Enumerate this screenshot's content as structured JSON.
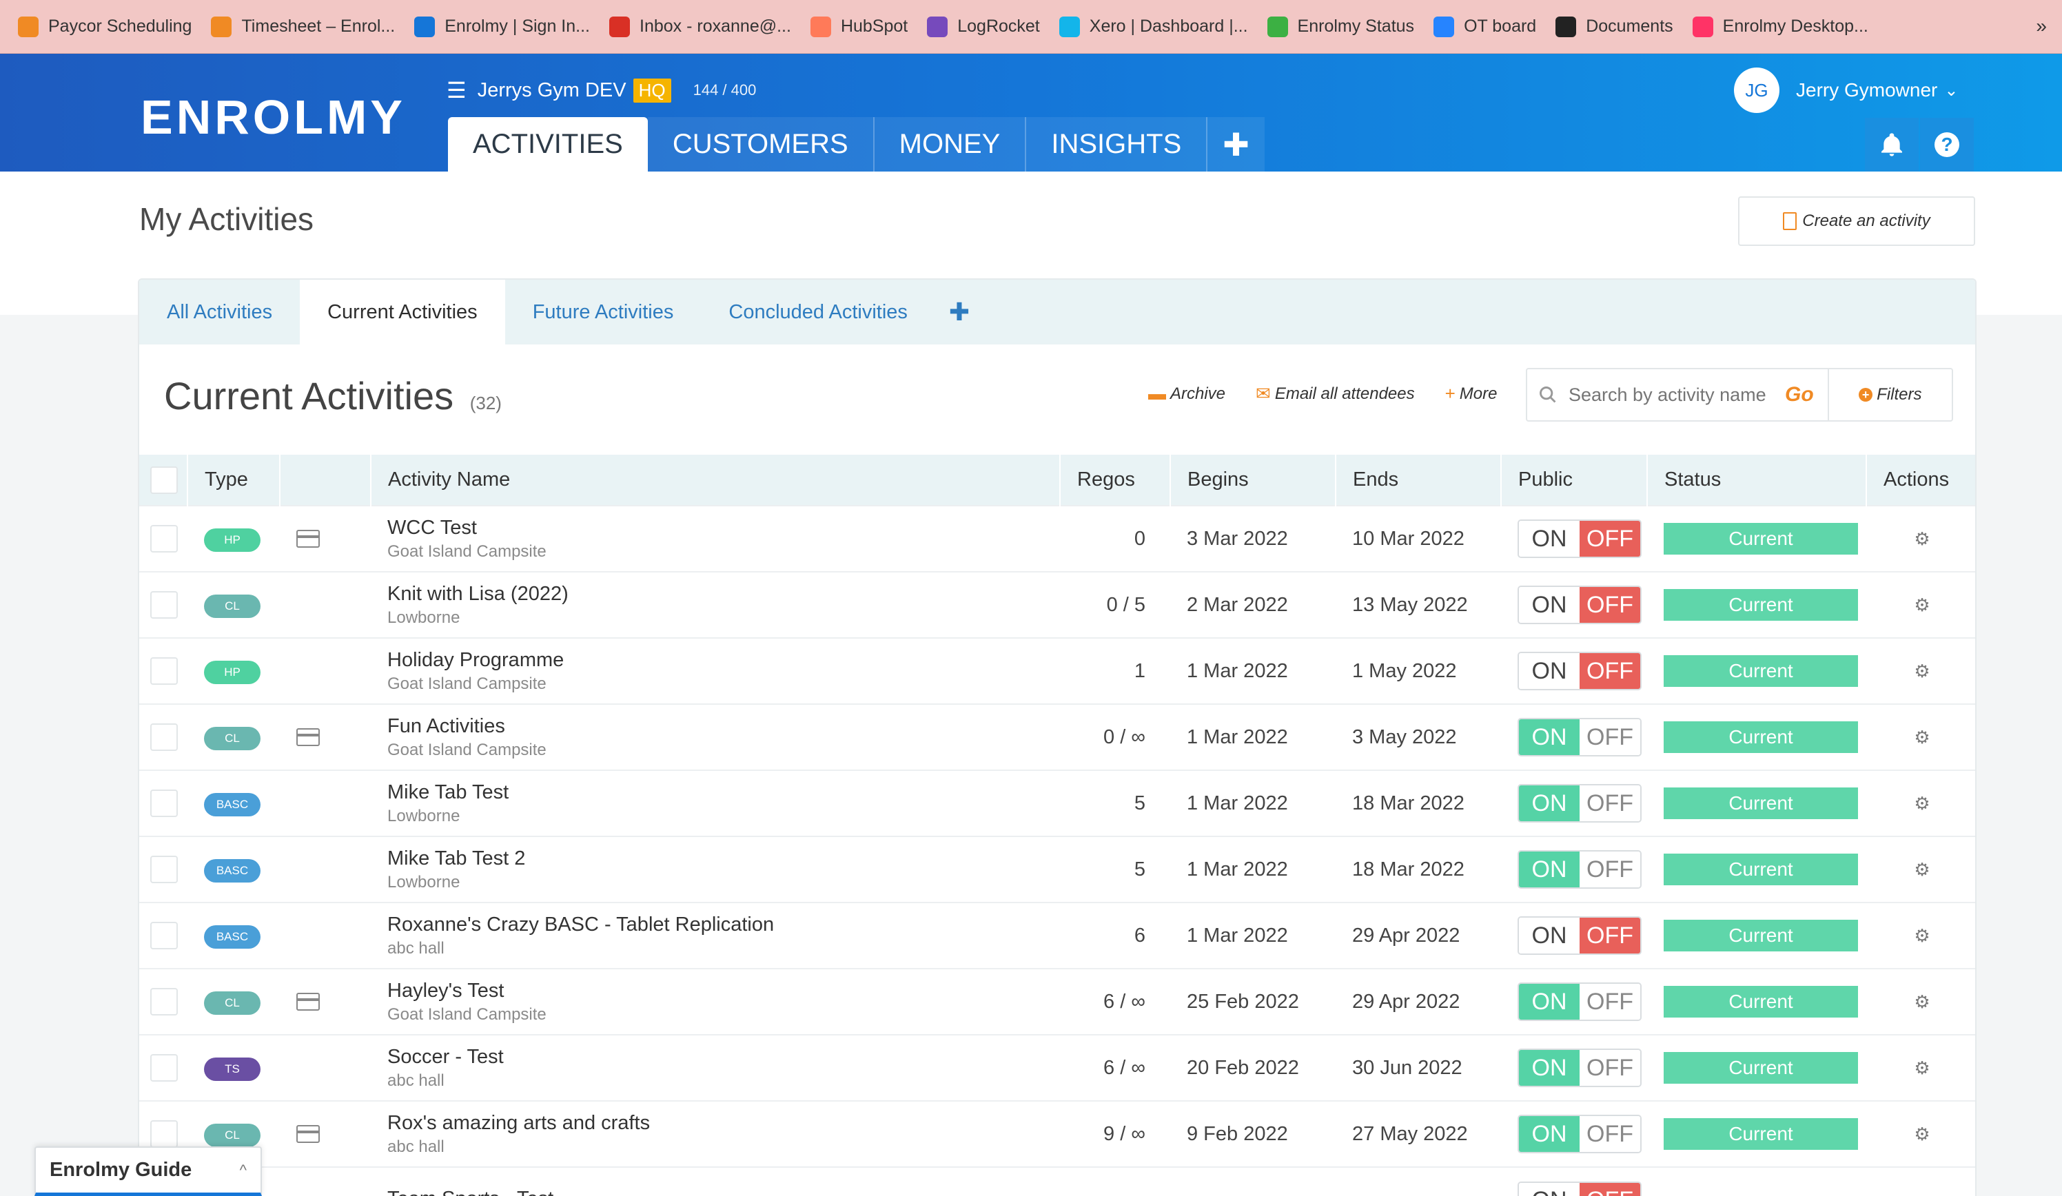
{
  "bookmarks": [
    {
      "label": "Paycor Scheduling",
      "icon": "paycor-icon",
      "color": "#f08a24"
    },
    {
      "label": "Timesheet – Enrol...",
      "icon": "timesheet-icon",
      "color": "#f08a24"
    },
    {
      "label": "Enrolmy | Sign In...",
      "icon": "enrolmy-icon",
      "color": "#1576d8"
    },
    {
      "label": "Inbox - roxanne@...",
      "icon": "gmail-icon",
      "color": "#d93025"
    },
    {
      "label": "HubSpot",
      "icon": "hubspot-icon",
      "color": "#ff7a59"
    },
    {
      "label": "LogRocket",
      "icon": "logrocket-icon",
      "color": "#764abc"
    },
    {
      "label": "Xero | Dashboard |...",
      "icon": "xero-icon",
      "color": "#13b5ea"
    },
    {
      "label": "Enrolmy Status",
      "icon": "status-icon",
      "color": "#3cb043"
    },
    {
      "label": "OT board",
      "icon": "jira-icon",
      "color": "#2684ff"
    },
    {
      "label": "Documents",
      "icon": "documents-icon",
      "color": "#222222"
    },
    {
      "label": "Enrolmy Desktop...",
      "icon": "invision-icon",
      "color": "#ff3366"
    }
  ],
  "bookmarks_more": "»",
  "header": {
    "logo": "ENROLMY",
    "org_name": "Jerrys Gym DEV",
    "org_badge": "HQ",
    "org_count": "144 / 400",
    "user_initials": "JG",
    "user_name": "Jerry Gymowner",
    "user_chevron": "⌄",
    "help_glyph": "?"
  },
  "nav": {
    "tabs": [
      {
        "label": "ACTIVITIES",
        "active": true
      },
      {
        "label": "CUSTOMERS",
        "active": false
      },
      {
        "label": "MONEY",
        "active": false
      },
      {
        "label": "INSIGHTS",
        "active": false
      }
    ],
    "plus": "✚"
  },
  "page": {
    "title": "My Activities",
    "create_label": "Create an activity"
  },
  "subtabs": {
    "items": [
      {
        "label": "All Activities",
        "active": false
      },
      {
        "label": "Current Activities",
        "active": true
      },
      {
        "label": "Future Activities",
        "active": false
      },
      {
        "label": "Concluded Activities",
        "active": false
      }
    ],
    "plus": "✚"
  },
  "list": {
    "title": "Current Activities",
    "count": "(32)",
    "archive_label": "Archive",
    "email_label": "Email all attendees",
    "more_label": "More",
    "search_placeholder": "Search by activity name",
    "go_label": "Go",
    "filters_label": "Filters"
  },
  "table": {
    "headers": [
      "Type",
      "Activity Name",
      "Regos",
      "Begins",
      "Ends",
      "Public",
      "Status",
      "Actions"
    ],
    "rows": [
      {
        "type": "HP",
        "type_color": "#4fd1a0",
        "card": true,
        "name": "WCC Test",
        "location": "Goat Island Campsite",
        "regos": "0",
        "begins": "3 Mar 2022",
        "ends": "10 Mar 2022",
        "public": "off",
        "status": "Current"
      },
      {
        "type": "CL",
        "type_color": "#6ab7b0",
        "card": false,
        "name": "Knit with Lisa (2022)",
        "location": "Lowborne",
        "regos": "0 / 5",
        "begins": "2 Mar 2022",
        "ends": "13 May 2022",
        "public": "off",
        "status": "Current"
      },
      {
        "type": "HP",
        "type_color": "#4fd1a0",
        "card": false,
        "name": "Holiday Programme",
        "location": "Goat Island Campsite",
        "regos": "1",
        "begins": "1 Mar 2022",
        "ends": "1 May 2022",
        "public": "off",
        "status": "Current"
      },
      {
        "type": "CL",
        "type_color": "#6ab7b0",
        "card": true,
        "name": "Fun Activities",
        "location": "Goat Island Campsite",
        "regos": "0 / ∞",
        "begins": "1 Mar 2022",
        "ends": "3 May 2022",
        "public": "on",
        "status": "Current"
      },
      {
        "type": "BASC",
        "type_color": "#4a9fd8",
        "card": false,
        "name": "Mike Tab Test",
        "location": "Lowborne",
        "regos": "5",
        "begins": "1 Mar 2022",
        "ends": "18 Mar 2022",
        "public": "on",
        "status": "Current"
      },
      {
        "type": "BASC",
        "type_color": "#4a9fd8",
        "card": false,
        "name": "Mike Tab Test 2",
        "location": "Lowborne",
        "regos": "5",
        "begins": "1 Mar 2022",
        "ends": "18 Mar 2022",
        "public": "on",
        "status": "Current"
      },
      {
        "type": "BASC",
        "type_color": "#4a9fd8",
        "card": false,
        "name": "Roxanne's Crazy BASC - Tablet Replication",
        "location": "abc hall",
        "regos": "6",
        "begins": "1 Mar 2022",
        "ends": "29 Apr 2022",
        "public": "off",
        "status": "Current"
      },
      {
        "type": "CL",
        "type_color": "#6ab7b0",
        "card": true,
        "name": "Hayley's Test",
        "location": "Goat Island Campsite",
        "regos": "6 / ∞",
        "begins": "25 Feb 2022",
        "ends": "29 Apr 2022",
        "public": "on",
        "status": "Current"
      },
      {
        "type": "TS",
        "type_color": "#6a4fa3",
        "card": false,
        "name": "Soccer - Test",
        "location": "abc hall",
        "regos": "6 / ∞",
        "begins": "20 Feb 2022",
        "ends": "30 Jun 2022",
        "public": "on",
        "status": "Current"
      },
      {
        "type": "CL",
        "type_color": "#6ab7b0",
        "card": true,
        "name": "Rox's amazing arts and crafts",
        "location": "abc hall",
        "regos": "9 / ∞",
        "begins": "9 Feb 2022",
        "ends": "27 May 2022",
        "public": "on",
        "status": "Current"
      },
      {
        "type": "",
        "type_color": "#ffffff",
        "card": false,
        "name": "Team Sports - Test",
        "location": "",
        "regos": "",
        "begins": "",
        "ends": "",
        "public": "off",
        "status": ""
      }
    ],
    "on_label": "ON",
    "off_label": "OFF",
    "gear": "⚙"
  },
  "guide": {
    "label": "Enrolmy Guide",
    "chevron": "^"
  }
}
